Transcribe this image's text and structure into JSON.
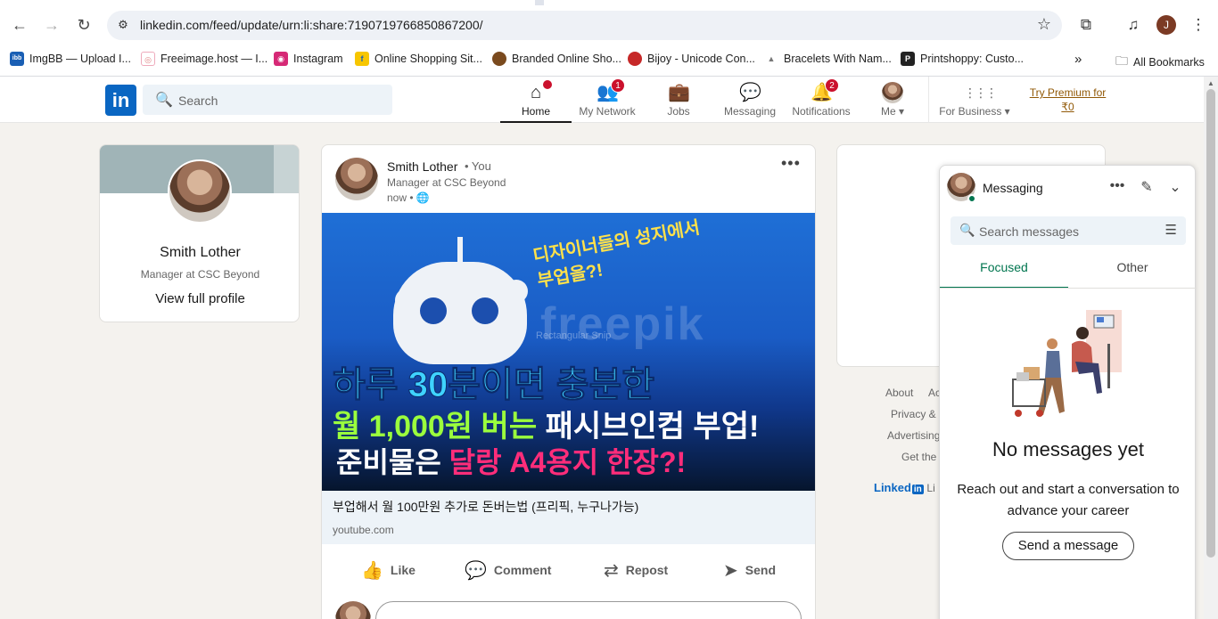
{
  "browser": {
    "url": "linkedin.com/feed/update/urn:li:share:7190719766850867200/",
    "profile_initial": "J",
    "bookmarks": [
      {
        "label": "ImgBB — Upload I...",
        "icon": "imgbb-icon",
        "color": "#1a5fb4",
        "glyph": "ibb"
      },
      {
        "label": "Freeimage.host — I...",
        "icon": "freeimage-icon",
        "color": "#e0a0a0",
        "glyph": "◎"
      },
      {
        "label": "Instagram",
        "icon": "instagram-icon",
        "color": "#d62976",
        "glyph": "◉"
      },
      {
        "label": "Online Shopping Sit...",
        "icon": "flipkart-icon",
        "color": "#f7c600",
        "glyph": "f"
      },
      {
        "label": "Branded Online Sho...",
        "icon": "brand-shop-icon",
        "color": "#7a4a1e",
        "glyph": "●"
      },
      {
        "label": "Bijoy - Unicode Con...",
        "icon": "bijoy-icon",
        "color": "#c62828",
        "glyph": "●"
      },
      {
        "label": "Bracelets With Nam...",
        "icon": "bracelets-icon",
        "color": "#777777",
        "glyph": "▲"
      },
      {
        "label": "Printshoppy: Custo...",
        "icon": "printshoppy-icon",
        "color": "#222222",
        "glyph": "P"
      }
    ],
    "all_bookmarks": "All Bookmarks"
  },
  "linkedin": {
    "search_placeholder": "Search",
    "nav": [
      {
        "label": "Home",
        "icon": "home-icon",
        "glyph": "⌂",
        "badge": "",
        "dot": true,
        "active": true
      },
      {
        "label": "My Network",
        "icon": "network-icon",
        "glyph": "👥",
        "badge": "1",
        "dot": false,
        "active": false
      },
      {
        "label": "Jobs",
        "icon": "jobs-icon",
        "glyph": "💼",
        "badge": "",
        "dot": false,
        "active": false
      },
      {
        "label": "Messaging",
        "icon": "messaging-icon",
        "glyph": "💬",
        "badge": "",
        "dot": false,
        "active": false
      },
      {
        "label": "Notifications",
        "icon": "bell-icon",
        "glyph": "🔔",
        "badge": "2",
        "dot": false,
        "active": false
      }
    ],
    "me_label": "Me",
    "business_label": "For Business",
    "premium_line1": "Try Premium for",
    "premium_line2": "₹0"
  },
  "profile_card": {
    "name": "Smith Lother",
    "headline": "Manager at CSC Beyond",
    "view_profile": "View full profile"
  },
  "post": {
    "author": "Smith Lother",
    "you": "• You",
    "headline": "Manager at CSC Beyond",
    "time": "now •",
    "image_text": {
      "top_yellow": "디자이너들의 성지에서 부업을?!",
      "watermark": "freepik",
      "snip": "Rectangular Snip",
      "line1": "하루 30분이면 충분한",
      "line2_green": "월 1,000원 버는",
      "line2_white": "패시브인컴 부업!",
      "line3_white": "준비물은",
      "line3_pink": "달랑 A4용지 한장?!"
    },
    "link_title": "부업해서 월 100만원 추가로 돈버는법 (프리픽, 누구나가능)",
    "link_domain": "youtube.com",
    "actions": [
      {
        "label": "Like",
        "icon": "like-icon",
        "glyph": "👍"
      },
      {
        "label": "Comment",
        "icon": "comment-icon",
        "glyph": "💬"
      },
      {
        "label": "Repost",
        "icon": "repost-icon",
        "glyph": "⇄"
      },
      {
        "label": "Send",
        "icon": "send-icon",
        "glyph": "➤"
      }
    ]
  },
  "footer": {
    "links": [
      "About",
      "Ac",
      "Privacy &",
      "Advertising",
      "Get the"
    ],
    "brand": "Linked",
    "brand_in": "in",
    "brand_suffix": "Li"
  },
  "messaging": {
    "title": "Messaging",
    "search_placeholder": "Search messages",
    "tabs": [
      "Focused",
      "Other"
    ],
    "empty_title": "No messages yet",
    "empty_desc": "Reach out and start a conversation to advance your career",
    "send_button": "Send a message"
  }
}
